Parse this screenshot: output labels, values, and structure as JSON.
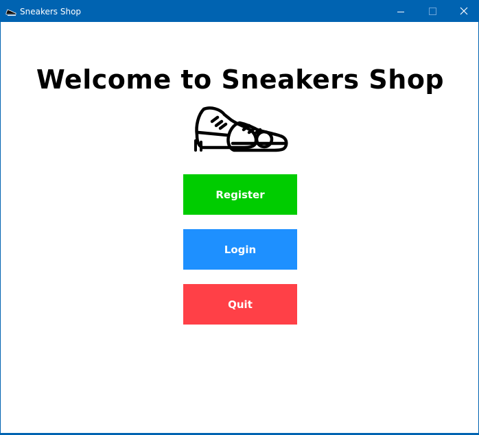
{
  "window": {
    "title": "Sneakers Shop",
    "app_icon": "sneaker-icon",
    "controls": {
      "minimize_icon": "minimize-icon",
      "maximize_icon": "maximize-icon",
      "close_icon": "close-icon"
    },
    "titlebar_color": "#0063b1"
  },
  "main": {
    "heading": "Welcome to Sneakers Shop",
    "logo_icon": "sneaker-icon",
    "buttons": {
      "register": {
        "label": "Register",
        "color": "#00cc00"
      },
      "login": {
        "label": "Login",
        "color": "#1e90ff"
      },
      "quit": {
        "label": "Quit",
        "color": "#ff4047"
      }
    }
  }
}
